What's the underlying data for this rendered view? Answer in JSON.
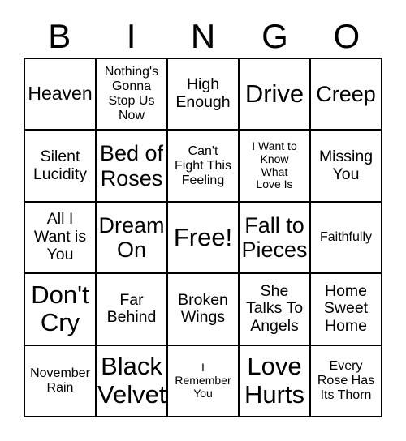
{
  "card": {
    "header_letters": [
      "B",
      "I",
      "N",
      "G",
      "O"
    ],
    "rows": [
      [
        {
          "text": "Heaven",
          "size": "lg"
        },
        {
          "text": "Nothing's\nGonna\nStop Us\nNow",
          "size": "sm"
        },
        {
          "text": "High\nEnough",
          "size": "md"
        },
        {
          "text": "Drive",
          "size": "xxl"
        },
        {
          "text": "Creep",
          "size": "xl"
        }
      ],
      [
        {
          "text": "Silent\nLucidity",
          "size": "md"
        },
        {
          "text": "Bed of\nRoses",
          "size": "xl"
        },
        {
          "text": "Can't\nFight This\nFeeling",
          "size": "sm"
        },
        {
          "text": "I Want to\nKnow\nWhat\nLove Is",
          "size": "xs"
        },
        {
          "text": "Missing\nYou",
          "size": "md"
        }
      ],
      [
        {
          "text": "All I\nWant is\nYou",
          "size": "md"
        },
        {
          "text": "Dream\nOn",
          "size": "xl"
        },
        {
          "text": "Free!",
          "size": "xxl"
        },
        {
          "text": "Fall to\nPieces",
          "size": "xl"
        },
        {
          "text": "Faithfully",
          "size": "sm"
        }
      ],
      [
        {
          "text": "Don't\nCry",
          "size": "xxl"
        },
        {
          "text": "Far\nBehind",
          "size": "md"
        },
        {
          "text": "Broken\nWings",
          "size": "md"
        },
        {
          "text": "She\nTalks To\nAngels",
          "size": "md"
        },
        {
          "text": "Home\nSweet\nHome",
          "size": "md"
        }
      ],
      [
        {
          "text": "November\nRain",
          "size": "sm"
        },
        {
          "text": "Black\nVelvet",
          "size": "xxl"
        },
        {
          "text": "I\nRemember\nYou",
          "size": "xs"
        },
        {
          "text": "Love\nHurts",
          "size": "xxl"
        },
        {
          "text": "Every\nRose Has\nIts Thorn",
          "size": "sm"
        }
      ]
    ]
  },
  "colors": {
    "border": "#000000",
    "background": "#ffffff",
    "text": "#000000"
  }
}
